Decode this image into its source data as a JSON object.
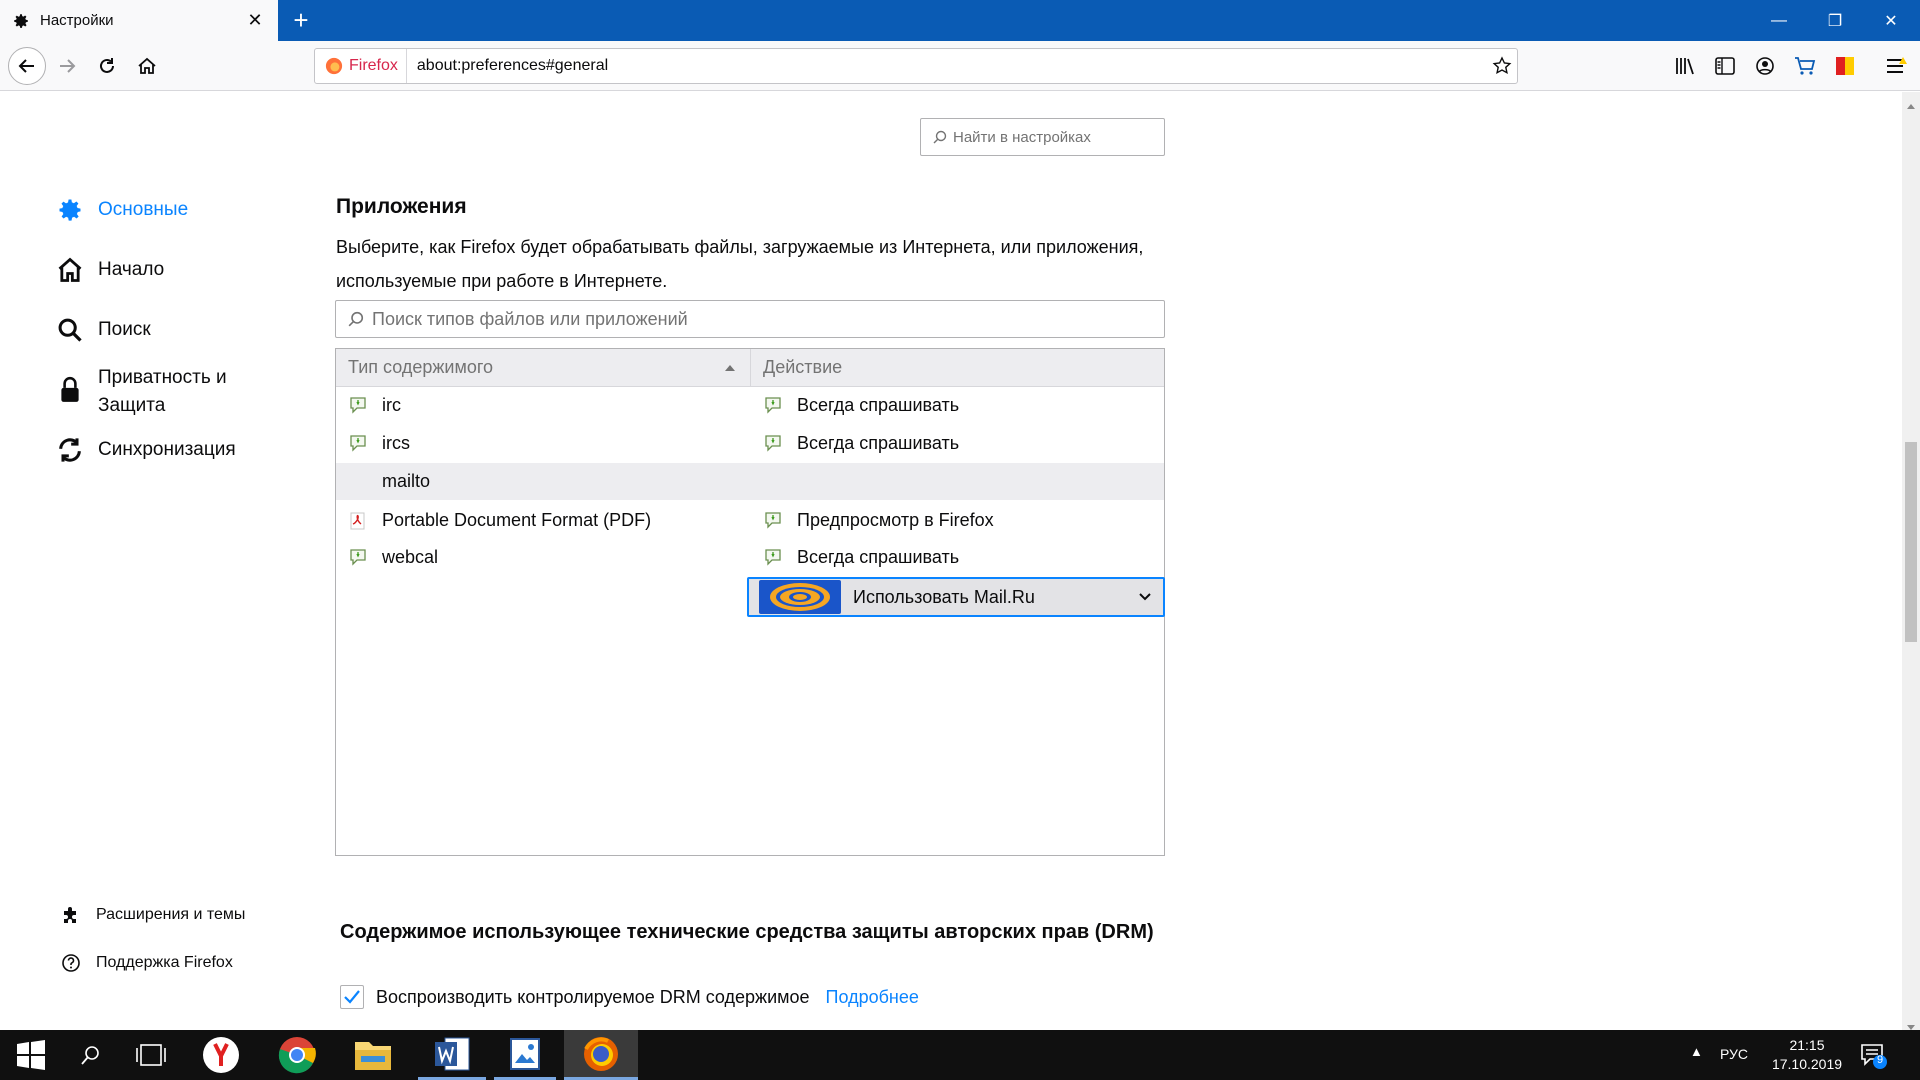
{
  "browser": {
    "tab_title": "Настройки",
    "tab_close": "✕",
    "new_tab": "+",
    "identity_label": "Firefox",
    "url": "about:preferences#general",
    "window_controls": {
      "minimize": "—",
      "restore": "❐",
      "close": "✕"
    }
  },
  "search": {
    "placeholder": "Найти в настройках"
  },
  "sidebar": {
    "items": [
      {
        "label": "Основные",
        "icon": "gear-icon",
        "selected": true
      },
      {
        "label": "Начало",
        "icon": "home-icon",
        "selected": false
      },
      {
        "label": "Поиск",
        "icon": "search-icon",
        "selected": false
      },
      {
        "label": "Приватность и\nЗащита",
        "icon": "lock-icon",
        "selected": false
      },
      {
        "label": "Синхронизация",
        "icon": "sync-icon",
        "selected": false
      }
    ],
    "footer": [
      {
        "label": "Расширения и темы",
        "icon": "puzzle-icon"
      },
      {
        "label": "Поддержка Firefox",
        "icon": "help-icon"
      }
    ]
  },
  "applications": {
    "heading": "Приложения",
    "description": "Выберите, как Firefox будет обрабатывать файлы, загружаемые из Интернета, или приложения, используемые при работе в Интернете.",
    "search_placeholder": "Поиск типов файлов или приложений",
    "columns": {
      "type": "Тип содержимого",
      "action": "Действие"
    },
    "rows": [
      {
        "type": "irc",
        "action": "Всегда спрашивать"
      },
      {
        "type": "ircs",
        "action": "Всегда спрашивать"
      },
      {
        "type": "mailto",
        "action": "Использовать Mail.Ru",
        "selected": true
      },
      {
        "type": "Portable Document Format (PDF)",
        "action": "Предпросмотр в Firefox"
      },
      {
        "type": "webcal",
        "action": "Всегда спрашивать"
      }
    ]
  },
  "drm": {
    "heading": "Содержимое использующее технические средства защиты авторских прав (DRM)",
    "checkbox_label": "Воспроизводить контролируемое DRM содержимое",
    "checked": true,
    "link": "Подробнее"
  },
  "taskbar": {
    "language": "РУС",
    "time": "21:15",
    "date": "17.10.2019",
    "notifications": "9"
  },
  "colors": {
    "accent": "#0a84ff",
    "titlebar": "#0a5bb4",
    "mailru_orange": "#f5a623"
  }
}
